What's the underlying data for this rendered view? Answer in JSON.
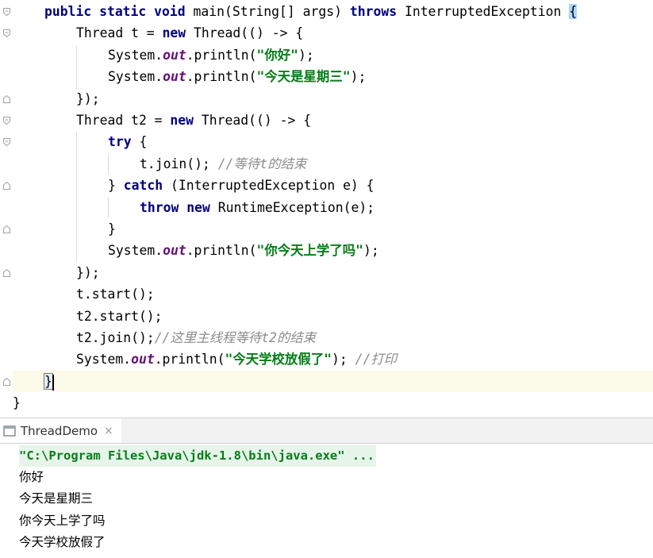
{
  "editor": {
    "lines": [
      {
        "tokens": [
          [
            "kw",
            "public "
          ],
          [
            "kw",
            "static "
          ],
          [
            "kw",
            "void "
          ],
          [
            "p",
            "main(String[] args) "
          ],
          [
            "kw",
            "throws "
          ],
          [
            "p",
            "InterruptedException "
          ],
          [
            "bh",
            "{"
          ]
        ]
      },
      {
        "tokens": [
          [
            "p",
            "Thread t = "
          ],
          [
            "kw",
            "new "
          ],
          [
            "p",
            "Thread(() -> {"
          ]
        ]
      },
      {
        "tokens": [
          [
            "p",
            "System."
          ],
          [
            "fld",
            "out"
          ],
          [
            "p",
            ".println("
          ],
          [
            "str",
            "\"你好\""
          ],
          [
            "p",
            ");"
          ]
        ]
      },
      {
        "tokens": [
          [
            "p",
            "System."
          ],
          [
            "fld",
            "out"
          ],
          [
            "p",
            ".println("
          ],
          [
            "str",
            "\"今天是星期三\""
          ],
          [
            "p",
            ");"
          ]
        ]
      },
      {
        "tokens": [
          [
            "p",
            "});"
          ]
        ]
      },
      {
        "tokens": [
          [
            "p",
            "Thread t2 = "
          ],
          [
            "kw",
            "new "
          ],
          [
            "p",
            "Thread(() -> {"
          ]
        ]
      },
      {
        "tokens": [
          [
            "kw",
            "try "
          ],
          [
            "p",
            "{"
          ]
        ]
      },
      {
        "tokens": [
          [
            "p",
            "t.join(); "
          ],
          [
            "cmt",
            "//等待t的结束"
          ]
        ]
      },
      {
        "tokens": [
          [
            "p",
            "} "
          ],
          [
            "kw",
            "catch "
          ],
          [
            "p",
            "(InterruptedException e) {"
          ]
        ]
      },
      {
        "tokens": [
          [
            "kw",
            "throw "
          ],
          [
            "kw",
            "new "
          ],
          [
            "p",
            "RuntimeException(e);"
          ]
        ]
      },
      {
        "tokens": [
          [
            "p",
            "}"
          ]
        ]
      },
      {
        "tokens": [
          [
            "p",
            "System."
          ],
          [
            "fld",
            "out"
          ],
          [
            "p",
            ".println("
          ],
          [
            "str",
            "\"你今天上学了吗\""
          ],
          [
            "p",
            ");"
          ]
        ]
      },
      {
        "tokens": [
          [
            "p",
            "});"
          ]
        ]
      },
      {
        "tokens": [
          [
            "p",
            "t.start();"
          ]
        ]
      },
      {
        "tokens": [
          [
            "p",
            "t2.start();"
          ]
        ]
      },
      {
        "tokens": [
          [
            "p",
            "t2.join();"
          ],
          [
            "cmt",
            "//这里主线程等待t2的结束"
          ]
        ]
      },
      {
        "tokens": [
          [
            "p",
            "System."
          ],
          [
            "fld",
            "out"
          ],
          [
            "p",
            ".println("
          ],
          [
            "str",
            "\"今天学校放假了\""
          ],
          [
            "p",
            "); "
          ],
          [
            "cmt",
            "//打印"
          ]
        ]
      },
      {
        "tokens": [
          [
            "bm",
            "}"
          ]
        ]
      },
      {
        "tokens": [
          [
            "p",
            "}"
          ]
        ]
      }
    ]
  },
  "run_tab": {
    "label": "ThreadDemo",
    "close_glyph": "×",
    "icon": "run-config-icon"
  },
  "console": {
    "command": "\"C:\\Program Files\\Java\\jdk-1.8\\bin\\java.exe\" ...",
    "output": [
      "你好",
      "今天是星期三",
      "你今天上学了吗",
      "今天学校放假了"
    ]
  },
  "colors": {
    "keyword": "#000080",
    "field": "#660e7a",
    "string": "#067d17",
    "comment": "#8c8c8c",
    "current_line": "#fcfae8"
  }
}
